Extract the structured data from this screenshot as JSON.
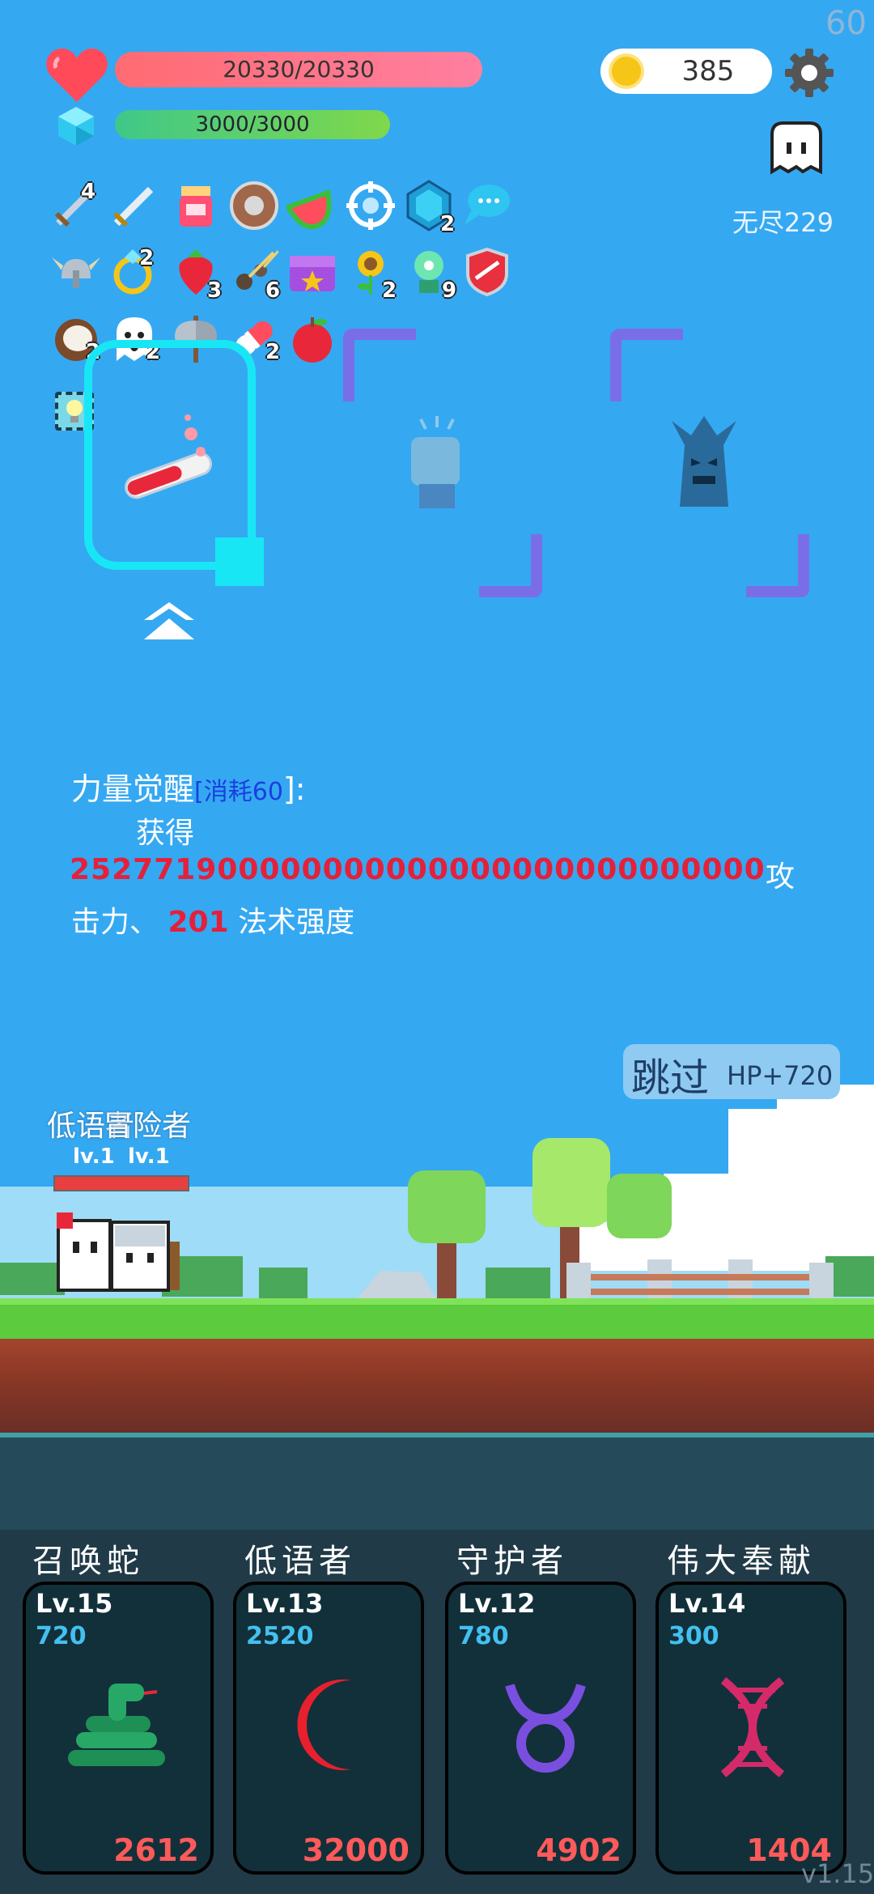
{
  "fps": "60",
  "hud": {
    "hp": "20330/20330",
    "mp": "3000/3000",
    "coins": "385",
    "mode": "无尽229"
  },
  "items": [
    {
      "icon": "sword-icon",
      "badge": "4"
    },
    {
      "icon": "sword-icon",
      "badge": ""
    },
    {
      "icon": "jam-jar-icon",
      "badge": ""
    },
    {
      "icon": "shield-icon",
      "badge": ""
    },
    {
      "icon": "watermelon-icon",
      "badge": ""
    },
    {
      "icon": "target-icon",
      "badge": ""
    },
    {
      "icon": "gem-icon",
      "badge": "2"
    },
    {
      "icon": "speech-bubble-icon",
      "badge": ""
    },
    {
      "icon": "viking-helmet-icon",
      "badge": ""
    },
    {
      "icon": "ring-icon",
      "badge": "2"
    },
    {
      "icon": "strawberry-icon",
      "badge": "3"
    },
    {
      "icon": "meteor-icon",
      "badge": "6"
    },
    {
      "icon": "chest-icon",
      "badge": ""
    },
    {
      "icon": "sunflower-icon",
      "badge": "2"
    },
    {
      "icon": "potion-icon",
      "badge": "9"
    },
    {
      "icon": "badge-icon",
      "badge": ""
    },
    {
      "icon": "coconut-icon",
      "badge": "2"
    },
    {
      "icon": "ghost-icon",
      "badge": "2"
    },
    {
      "icon": "axe-icon",
      "badge": ""
    },
    {
      "icon": "pill-icon",
      "badge": "2"
    },
    {
      "icon": "apple-icon",
      "badge": ""
    },
    {
      "icon": "lightbulb-icon",
      "badge": ""
    }
  ],
  "awaken": {
    "title": "力量觉醒",
    "cost_open": "[",
    "cost": "消耗60",
    "cost_close": "]:",
    "gain": "获得",
    "attack_value": "252771900000000000000000000000000",
    "attack_suffix": "攻",
    "line2_prefix": "击力、",
    "magic_value": "201",
    "magic_suffix": "法术强度"
  },
  "skip": {
    "label": "跳过",
    "hp": "HP+720"
  },
  "heroes": [
    {
      "name": "低语者",
      "level": "lv.1"
    },
    {
      "name": "冒险者",
      "level": "lv.1"
    }
  ],
  "skills": [
    {
      "title": "召唤蛇",
      "level": "Lv.15",
      "value": "720",
      "cost": "2612",
      "icon": "snake-icon",
      "color": "#1e8f55"
    },
    {
      "title": "低语者",
      "level": "Lv.13",
      "value": "2520",
      "cost": "32000",
      "icon": "crescent-moon-icon",
      "color": "#e8202e"
    },
    {
      "title": "守护者",
      "level": "Lv.12",
      "value": "780",
      "cost": "4902",
      "icon": "taurus-icon",
      "color": "#7a4fe0"
    },
    {
      "title": "伟大奉献",
      "level": "Lv.14",
      "value": "300",
      "cost": "1404",
      "icon": "dna-icon",
      "color": "#d42a6a"
    }
  ],
  "version": "v1.15"
}
